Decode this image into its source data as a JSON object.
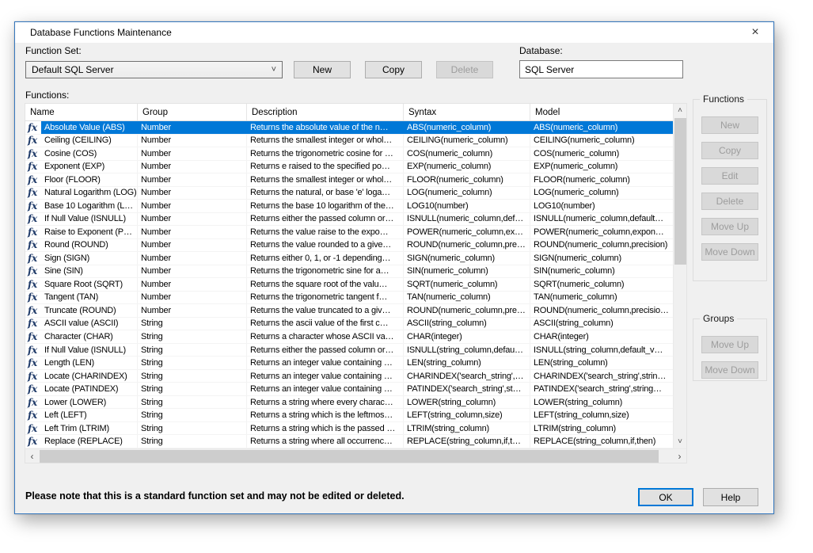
{
  "window": {
    "title": "Database Functions Maintenance",
    "close_glyph": "×"
  },
  "toolbar": {
    "function_set_label": "Function Set:",
    "function_set_value": "Default SQL Server",
    "combo_chevron": "˅",
    "new_label": "New",
    "copy_label": "Copy",
    "delete_label": "Delete",
    "database_label": "Database:",
    "database_value": "SQL Server"
  },
  "functions_table": {
    "label": "Functions:",
    "columns": [
      "Name",
      "Group",
      "Description",
      "Syntax",
      "Model"
    ],
    "row_icon": "fx",
    "rows": [
      {
        "selected": true,
        "name": "Absolute Value (ABS)",
        "group": "Number",
        "description": "Returns the absolute value of the n…",
        "syntax": "ABS(numeric_column)",
        "model": "ABS(numeric_column)"
      },
      {
        "name": "Ceiling (CEILING)",
        "group": "Number",
        "description": "Returns the smallest integer or whol…",
        "syntax": "CEILING(numeric_column)",
        "model": "CEILING(numeric_column)"
      },
      {
        "name": "Cosine (COS)",
        "group": "Number",
        "description": "Returns the trigonometric cosine for …",
        "syntax": "COS(numeric_column)",
        "model": "COS(numeric_column)"
      },
      {
        "name": "Exponent (EXP)",
        "group": "Number",
        "description": "Returns e raised to the specified po…",
        "syntax": "EXP(numeric_column)",
        "model": "EXP(numeric_column)"
      },
      {
        "name": "Floor (FLOOR)",
        "group": "Number",
        "description": "Returns the smallest integer or whol…",
        "syntax": "FLOOR(numeric_column)",
        "model": "FLOOR(numeric_column)"
      },
      {
        "name": "Natural Logarithm (LOG)",
        "group": "Number",
        "description": "Returns the natural, or base 'e' loga…",
        "syntax": "LOG(numeric_column)",
        "model": "LOG(numeric_column)"
      },
      {
        "name": "Base 10 Logarithm (L…",
        "group": "Number",
        "description": "Returns the base 10 logarithm of the…",
        "syntax": "LOG10(number)",
        "model": "LOG10(number)"
      },
      {
        "name": "If Null Value (ISNULL)",
        "group": "Number",
        "description": "Returns either the passed column or…",
        "syntax": "ISNULL(numeric_column,def…",
        "model": "ISNULL(numeric_column,default…"
      },
      {
        "name": "Raise to Exponent (P…",
        "group": "Number",
        "description": "Returns the value raise to the expo…",
        "syntax": "POWER(numeric_column,ex…",
        "model": "POWER(numeric_column,expon…"
      },
      {
        "name": "Round (ROUND)",
        "group": "Number",
        "description": "Returns the value rounded to a give…",
        "syntax": "ROUND(numeric_column,pre…",
        "model": "ROUND(numeric_column,precision)"
      },
      {
        "name": "Sign (SIGN)",
        "group": "Number",
        "description": "Returns either 0, 1, or -1 depending…",
        "syntax": "SIGN(numeric_column)",
        "model": "SIGN(numeric_column)"
      },
      {
        "name": "Sine (SIN)",
        "group": "Number",
        "description": "Returns the trigonometric sine for a…",
        "syntax": "SIN(numeric_column)",
        "model": "SIN(numeric_column)"
      },
      {
        "name": "Square Root (SQRT)",
        "group": "Number",
        "description": "Returns the square root of the valu…",
        "syntax": "SQRT(numeric_column)",
        "model": "SQRT(numeric_column)"
      },
      {
        "name": "Tangent (TAN)",
        "group": "Number",
        "description": "Returns the trigonometric tangent f…",
        "syntax": "TAN(numeric_column)",
        "model": "TAN(numeric_column)"
      },
      {
        "name": "Truncate (ROUND)",
        "group": "Number",
        "description": "Returns the value truncated to a giv…",
        "syntax": "ROUND(numeric_column,pre…",
        "model": "ROUND(numeric_column,precisio…"
      },
      {
        "name": "ASCII value (ASCII)",
        "group": "String",
        "description": "Returns the ascii value of the first c…",
        "syntax": "ASCII(string_column)",
        "model": "ASCII(string_column)"
      },
      {
        "name": "Character (CHAR)",
        "group": "String",
        "description": "Returns a character whose ASCII va…",
        "syntax": "CHAR(integer)",
        "model": "CHAR(integer)"
      },
      {
        "name": "If Null Value (ISNULL)",
        "group": "String",
        "description": "Returns either the passed column or…",
        "syntax": "ISNULL(string_column,defau…",
        "model": "ISNULL(string_column,default_v…"
      },
      {
        "name": "Length (LEN)",
        "group": "String",
        "description": "Returns an integer value containing …",
        "syntax": "LEN(string_column)",
        "model": "LEN(string_column)"
      },
      {
        "name": "Locate (CHARINDEX)",
        "group": "String",
        "description": "Returns an integer value containing …",
        "syntax": "CHARINDEX('search_string',…",
        "model": "CHARINDEX('search_string',strin…"
      },
      {
        "name": "Locate (PATINDEX)",
        "group": "String",
        "description": "Returns an integer value containing …",
        "syntax": "PATINDEX('search_string',st…",
        "model": "PATINDEX('search_string',string…"
      },
      {
        "name": "Lower (LOWER)",
        "group": "String",
        "description": "Returns a string where every charac…",
        "syntax": "LOWER(string_column)",
        "model": "LOWER(string_column)"
      },
      {
        "name": "Left (LEFT)",
        "group": "String",
        "description": "Returns a string which is the leftmos…",
        "syntax": "LEFT(string_column,size)",
        "model": "LEFT(string_column,size)"
      },
      {
        "name": "Left Trim (LTRIM)",
        "group": "String",
        "description": "Returns a string which is the passed …",
        "syntax": "LTRIM(string_column)",
        "model": "LTRIM(string_column)"
      },
      {
        "name": "Replace (REPLACE)",
        "group": "String",
        "description": "Returns a string where all occurrenc…",
        "syntax": "REPLACE(string_column,if,t…",
        "model": "REPLACE(string_column,if,then)"
      }
    ],
    "scrollbar": {
      "up_glyph": "˄",
      "down_glyph": "˅",
      "left_glyph": "‹",
      "right_glyph": "›"
    }
  },
  "side_panel": {
    "functions_group": {
      "title": "Functions",
      "buttons": [
        "New",
        "Copy",
        "Edit",
        "Delete",
        "Move Up",
        "Move Down"
      ]
    },
    "groups_group": {
      "title": "Groups",
      "buttons": [
        "Move Up",
        "Move Down"
      ]
    }
  },
  "footer": {
    "note": "Please note that this is a standard function set and may not be edited or deleted.",
    "ok_label": "OK",
    "help_label": "Help"
  },
  "colors": {
    "selection": "#0078d7",
    "accent_border": "#0078d7",
    "dialog_border": "#3577bd",
    "fx_icon": "#1f3a68"
  }
}
